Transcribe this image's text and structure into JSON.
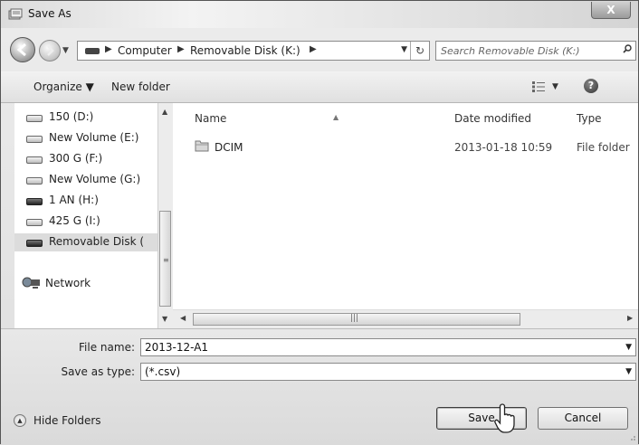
{
  "window": {
    "title": "Save As",
    "close_label": "X"
  },
  "nav": {
    "breadcrumb": [
      "Computer",
      "Removable Disk (K:)"
    ],
    "search_placeholder": "Search Removable Disk (K:)"
  },
  "toolbar": {
    "organize": "Organize ▼",
    "new_folder": "New folder"
  },
  "sidebar": {
    "items": [
      {
        "label": "150  (D:)",
        "icon": "drive-icon"
      },
      {
        "label": "New Volume (E:)",
        "icon": "drive-icon"
      },
      {
        "label": "300 G (F:)",
        "icon": "drive-icon"
      },
      {
        "label": "New Volume (G:)",
        "icon": "drive-icon"
      },
      {
        "label": "1 AN (H:)",
        "icon": "removable-drive-icon"
      },
      {
        "label": "425 G (I:)",
        "icon": "drive-icon"
      },
      {
        "label": "Removable Disk (",
        "icon": "removable-drive-icon",
        "selected": true
      }
    ],
    "network": "Network"
  },
  "files": {
    "columns": [
      "Name",
      "Date modified",
      "Type"
    ],
    "rows": [
      {
        "name": "DCIM",
        "date": "2013-01-18 10:59",
        "type": "File folder"
      }
    ]
  },
  "form": {
    "file_name_label": "File name:",
    "file_name_value": "2013-12-A1",
    "save_type_label": "Save as type:",
    "save_type_value": "(*.csv)"
  },
  "footer": {
    "hide_folders": "Hide Folders",
    "save": "Save",
    "cancel": "Cancel"
  },
  "colors": {
    "accent": "#8a8a8a",
    "selection": "#dcdcdc"
  }
}
